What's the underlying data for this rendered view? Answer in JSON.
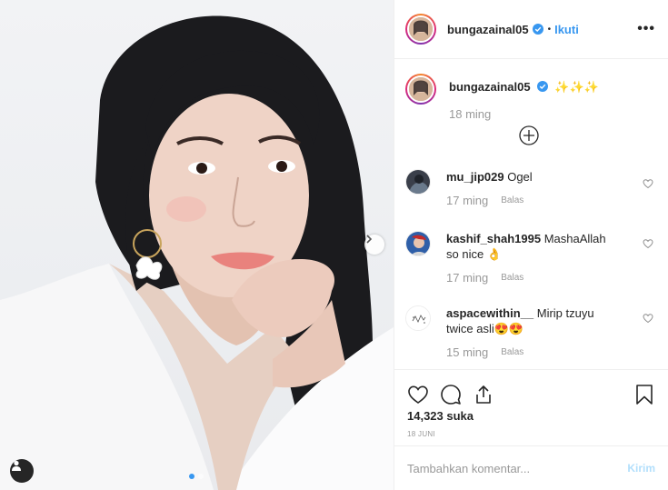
{
  "post": {
    "username": "bungazainal05",
    "follow_label": "Ikuti",
    "dot_sep": "•",
    "more_label": "•••",
    "caption_text": "✨✨✨",
    "caption_time": "18 ming",
    "likes": "14,323 suka",
    "date": "18 JUNI",
    "carousel_pages": 2,
    "carousel_active": 1
  },
  "comments": [
    {
      "username": "mu_jip029",
      "text": "Ogel",
      "time": "17 ming",
      "reply_label": "Balas"
    },
    {
      "username": "kashif_shah1995",
      "text": "MashaAllah so nice 👌",
      "time": "17 ming",
      "reply_label": "Balas"
    },
    {
      "username": "aspacewithin__",
      "text": "Mirip tzuyu twice asli😍😍",
      "time": "15 ming",
      "reply_label": "Balas"
    }
  ],
  "composer": {
    "placeholder": "Tambahkan komentar...",
    "post_label": "Kirim"
  },
  "icons": {
    "verified": "verified-badge-icon",
    "more": "more-options-icon",
    "load_more": "load-more-comments-icon",
    "heart": "heart-icon",
    "comment": "comment-icon",
    "share": "share-icon",
    "bookmark": "bookmark-icon",
    "next": "chevron-right-icon",
    "tag": "user-tag-icon"
  },
  "colors": {
    "accent": "#3897f0",
    "muted": "#999999",
    "post_disabled": "#b2dffc",
    "text": "#262626"
  }
}
